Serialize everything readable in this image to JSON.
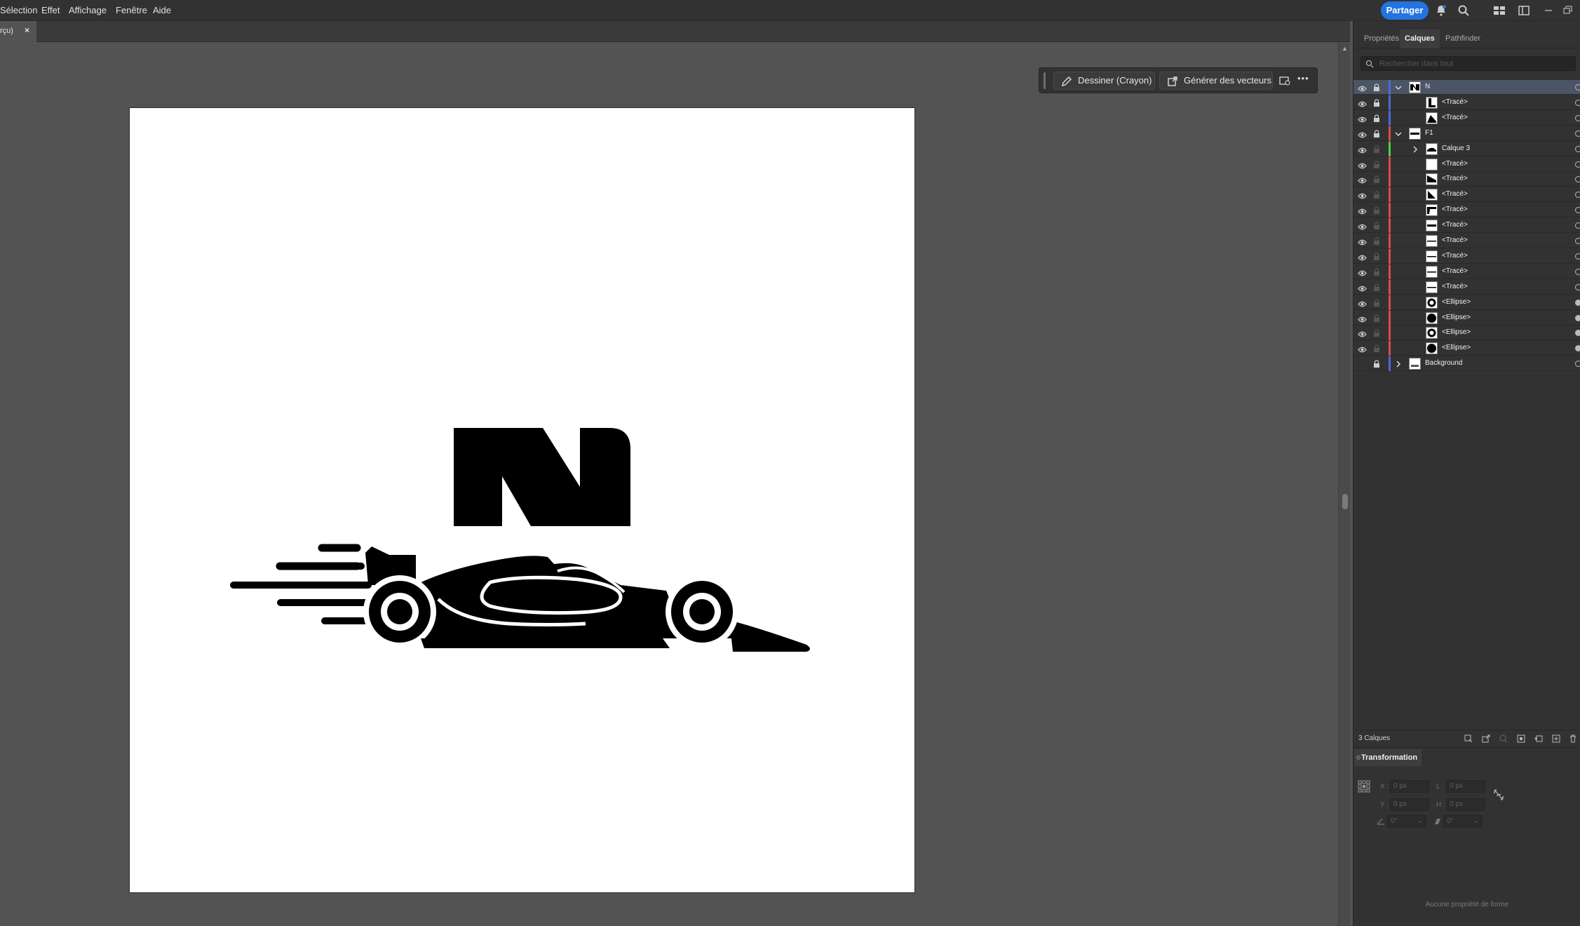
{
  "menu": {
    "items": [
      "Sélection",
      "Effet",
      "Affichage",
      "Fenêtre",
      "Aide"
    ],
    "share_label": "Partager"
  },
  "document": {
    "tab_label": "rçu)",
    "tab_close": "×"
  },
  "context_bar": {
    "draw_label": "Dessiner (Crayon)",
    "generate_label": "Générer des vecteurs",
    "more": "•••"
  },
  "artwork": {
    "description_icon": "n-letter-race-car-logo"
  },
  "panel": {
    "tabs": [
      "Propriétés",
      "Calques",
      "Pathfinder"
    ],
    "active_tab": "Calques",
    "search_placeholder": "Rechercher dans tout",
    "layers": [
      {
        "name": "N",
        "level": 0,
        "expanded": true,
        "color": "#4a6bd8",
        "locked": true,
        "visible": true,
        "selected": true,
        "thumb": "n"
      },
      {
        "name": "<Tracé>",
        "level": 1,
        "color": "#4a6bd8",
        "locked": true,
        "visible": true,
        "thumb": "path1"
      },
      {
        "name": "<Tracé>",
        "level": 1,
        "color": "#4a6bd8",
        "locked": true,
        "visible": true,
        "thumb": "path2"
      },
      {
        "name": "F1",
        "level": 0,
        "expanded": true,
        "color": "#e04a4a",
        "locked": true,
        "visible": true,
        "thumb": "f1"
      },
      {
        "name": "Calque 3",
        "level": 1,
        "collapsed": true,
        "color": "#4ad04a",
        "locked": false,
        "visible": true,
        "thumb": "car"
      },
      {
        "name": "<Tracé>",
        "level": 1,
        "color": "#e04a4a",
        "locked": false,
        "visible": true,
        "thumb": "blank"
      },
      {
        "name": "<Tracé>",
        "level": 1,
        "color": "#e04a4a",
        "locked": false,
        "visible": true,
        "thumb": "diag1"
      },
      {
        "name": "<Tracé>",
        "level": 1,
        "color": "#e04a4a",
        "locked": false,
        "visible": true,
        "thumb": "diag2"
      },
      {
        "name": "<Tracé>",
        "level": 1,
        "color": "#e04a4a",
        "locked": false,
        "visible": true,
        "thumb": "wedge"
      },
      {
        "name": "<Tracé>",
        "level": 1,
        "color": "#e04a4a",
        "locked": false,
        "visible": true,
        "thumb": "bar"
      },
      {
        "name": "<Tracé>",
        "level": 1,
        "color": "#e04a4a",
        "locked": false,
        "visible": true,
        "thumb": "line"
      },
      {
        "name": "<Tracé>",
        "level": 1,
        "color": "#e04a4a",
        "locked": false,
        "visible": true,
        "thumb": "line"
      },
      {
        "name": "<Tracé>",
        "level": 1,
        "color": "#e04a4a",
        "locked": false,
        "visible": true,
        "thumb": "line"
      },
      {
        "name": "<Tracé>",
        "level": 1,
        "color": "#e04a4a",
        "locked": false,
        "visible": true,
        "thumb": "line"
      },
      {
        "name": "<Ellipse>",
        "level": 1,
        "color": "#e04a4a",
        "locked": false,
        "visible": true,
        "thumb": "ring",
        "target_filled": true
      },
      {
        "name": "<Ellipse>",
        "level": 1,
        "color": "#e04a4a",
        "locked": false,
        "visible": true,
        "thumb": "disk",
        "target_filled": true
      },
      {
        "name": "<Ellipse>",
        "level": 1,
        "color": "#e04a4a",
        "locked": false,
        "visible": true,
        "thumb": "ring",
        "target_filled": true
      },
      {
        "name": "<Ellipse>",
        "level": 1,
        "color": "#e04a4a",
        "locked": false,
        "visible": true,
        "thumb": "disk",
        "target_filled": true
      },
      {
        "name": "Background",
        "level": 0,
        "collapsed": true,
        "color": "#4a6bd8",
        "locked": true,
        "visible": false,
        "thumb": "bg"
      }
    ],
    "layers_count": "3 Calques",
    "transform": {
      "title": "Transformation",
      "x_label": "X :",
      "x_value": "0 px",
      "y_label": "Y :",
      "y_value": "0 px",
      "w_label": "L :",
      "w_value": "0 px",
      "h_label": "H :",
      "h_value": "0 px",
      "rotate_value": "0°",
      "shear_value": "0°",
      "empty_message": "Aucune propriété de forme"
    }
  },
  "colors": {
    "accent": "#2374e1",
    "selected_row": "#4c5566",
    "layer_blue": "#4a6bd8",
    "layer_red": "#e04a4a",
    "layer_green": "#4ad04a"
  }
}
